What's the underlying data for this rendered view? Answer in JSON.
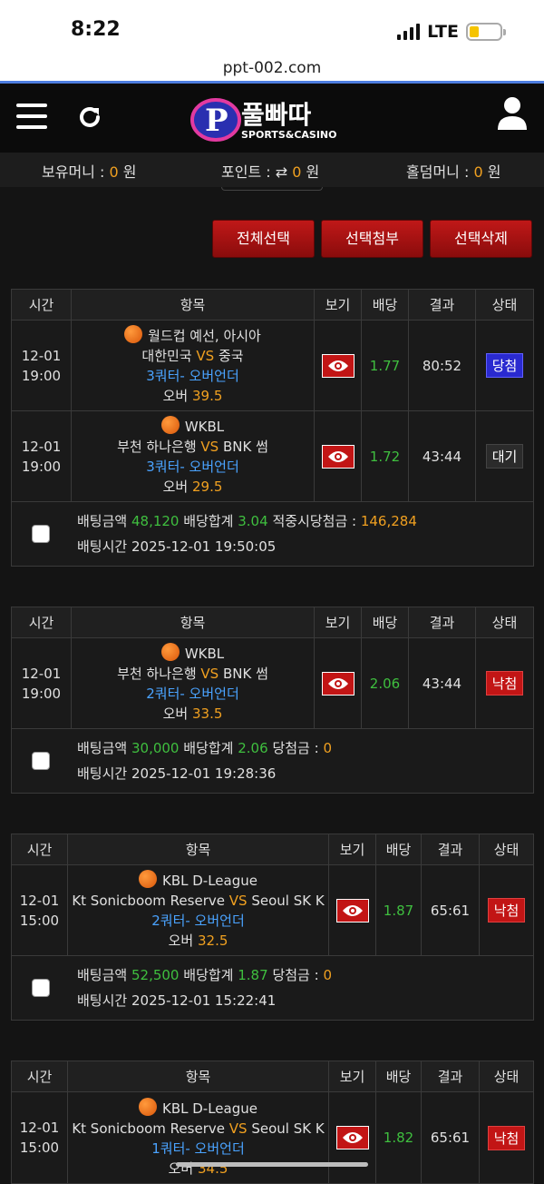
{
  "statusbar": {
    "time": "8:22",
    "network": "LTE"
  },
  "url": "ppt-002.com",
  "logo": {
    "name": "풀빠따",
    "sub": "SPORTS&CASINO"
  },
  "moneybar": {
    "holding_label": "보유머니 :",
    "holding_value": "0",
    "holding_unit": "원",
    "point_label": "포인트 :",
    "point_value": "0",
    "point_unit": "원",
    "holdem_label": "홀덤머니 :",
    "holdem_value": "0",
    "holdem_unit": "원"
  },
  "actions": {
    "select_all": "전체선택",
    "attach": "선택첨부",
    "delete": "선택삭제"
  },
  "columns": {
    "time": "시간",
    "item": "항목",
    "view": "보기",
    "odds": "배당",
    "result": "결과",
    "status": "상태"
  },
  "bets": [
    {
      "games": [
        {
          "date": "12-01",
          "clock": "19:00",
          "league": "월드컵 예선, 아시아",
          "home": "대한민국",
          "vs": "VS",
          "away": "중국",
          "market": "3쿼터- 오버언더",
          "pick": "오버",
          "line": "39.5",
          "odds": "1.77",
          "result": "80:52",
          "status": "당첨",
          "status_type": "win"
        },
        {
          "date": "12-01",
          "clock": "19:00",
          "league": "WKBL",
          "home": "부천 하나은행",
          "vs": "VS",
          "away": "BNK 썸",
          "market": "3쿼터- 오버언더",
          "pick": "오버",
          "line": "29.5",
          "odds": "1.72",
          "result": "43:44",
          "status": "대기",
          "status_type": "wait"
        }
      ],
      "summary": {
        "amount_label": "배팅금액",
        "amount": "48,120",
        "total_label": "배당합계",
        "total": "3.04",
        "payout_label": "적중시당첨금 :",
        "payout": "146,284",
        "time_label": "배팅시간",
        "time": "2025-12-01 19:50:05"
      }
    },
    {
      "games": [
        {
          "date": "12-01",
          "clock": "19:00",
          "league": "WKBL",
          "home": "부천 하나은행",
          "vs": "VS",
          "away": "BNK 썸",
          "market": "2쿼터- 오버언더",
          "pick": "오버",
          "line": "33.5",
          "odds": "2.06",
          "result": "43:44",
          "status": "낙첨",
          "status_type": "lose"
        }
      ],
      "summary": {
        "amount_label": "배팅금액",
        "amount": "30,000",
        "total_label": "배당합계",
        "total": "2.06",
        "payout_label": "당첨금 :",
        "payout": "0",
        "time_label": "배팅시간",
        "time": "2025-12-01 19:28:36"
      }
    },
    {
      "games": [
        {
          "date": "12-01",
          "clock": "15:00",
          "league": "KBL D-League",
          "home": "Kt Sonicboom Reserve",
          "vs": "VS",
          "away": "Seoul SK K",
          "market": "2쿼터- 오버언더",
          "pick": "오버",
          "line": "32.5",
          "odds": "1.87",
          "result": "65:61",
          "status": "낙첨",
          "status_type": "lose"
        }
      ],
      "summary": {
        "amount_label": "배팅금액",
        "amount": "52,500",
        "total_label": "배당합계",
        "total": "1.87",
        "payout_label": "당첨금 :",
        "payout": "0",
        "time_label": "배팅시간",
        "time": "2025-12-01 15:22:41"
      }
    },
    {
      "games": [
        {
          "date": "12-01",
          "clock": "15:00",
          "league": "KBL D-League",
          "home": "Kt Sonicboom Reserve",
          "vs": "VS",
          "away": "Seoul SK K",
          "market": "1쿼터- 오버언더",
          "pick": "오버",
          "line": "34.5",
          "odds": "1.82",
          "result": "65:61",
          "status": "낙첨",
          "status_type": "lose"
        }
      ]
    }
  ],
  "colors": {
    "accent_red": "#c21515",
    "win_blue": "#2a2ad0",
    "odds_green": "#3fbf3f",
    "value_orange": "#f0a020",
    "market_blue": "#4aa3ff"
  }
}
